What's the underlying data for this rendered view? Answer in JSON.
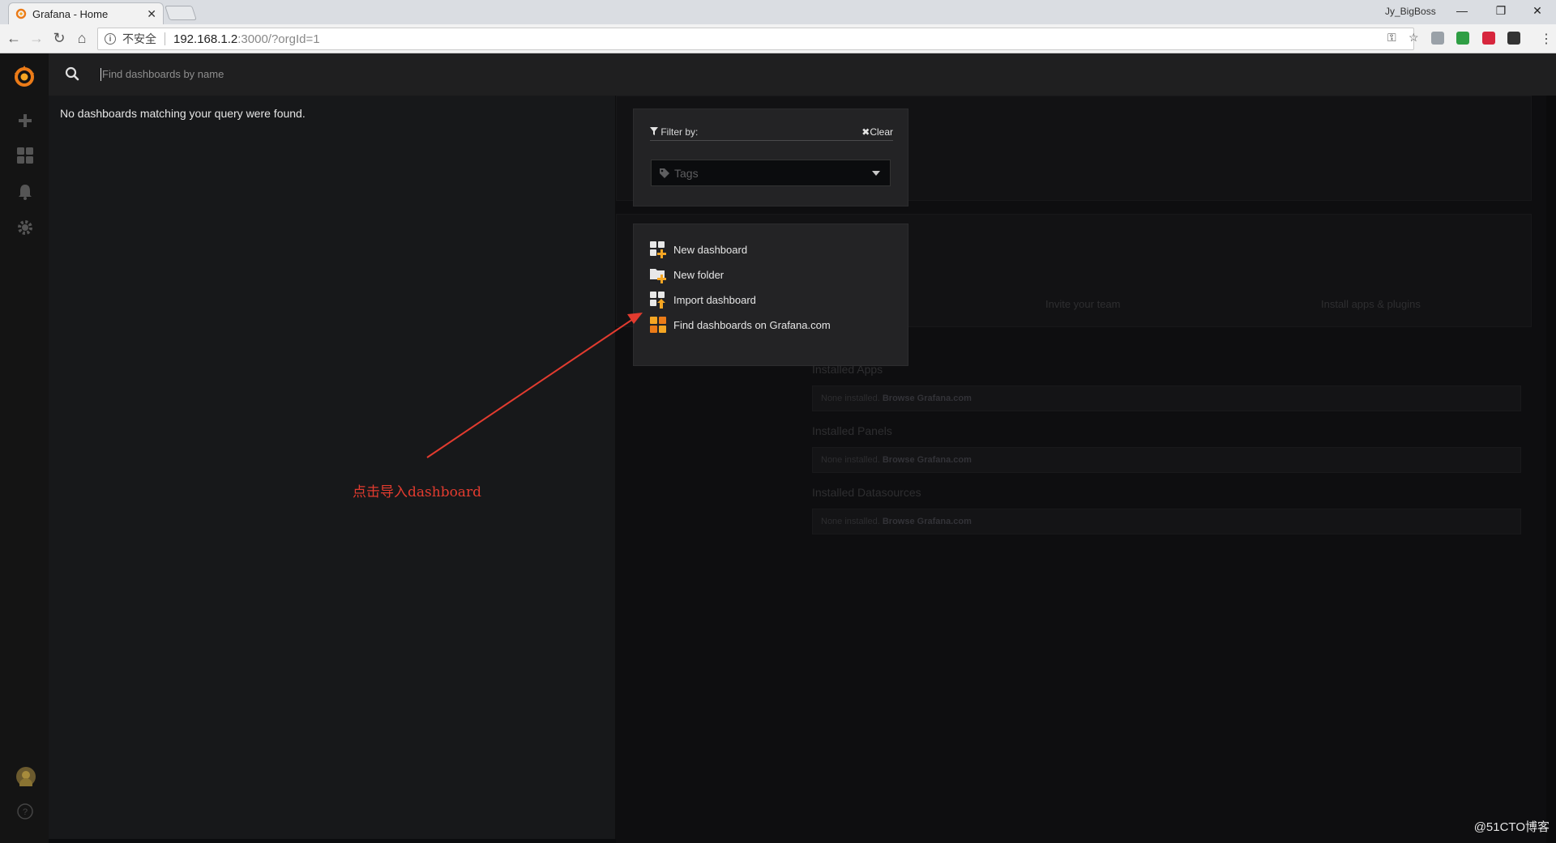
{
  "browser": {
    "tab_title": "Grafana - Home",
    "tab_close": "✕",
    "profile_name": "Jy_BigBoss",
    "window_buttons": [
      "—",
      "❐",
      "✕"
    ],
    "url_security": "不安全",
    "url_host": "192.168.1.2",
    "url_path": ":3000/?orgId=1"
  },
  "search": {
    "placeholder": "Find dashboards by name",
    "no_results": "No dashboards matching your query were found."
  },
  "filter": {
    "title": "Filter by:",
    "clear_label": "Clear",
    "tags_placeholder": "Tags"
  },
  "actions": [
    {
      "label": "New dashboard",
      "icon": "new-dashboard-icon"
    },
    {
      "label": "New folder",
      "icon": "new-folder-icon"
    },
    {
      "label": "Import dashboard",
      "icon": "import-dashboard-icon"
    },
    {
      "label": "Find dashboards on Grafana.com",
      "icon": "grafana-com-icon"
    }
  ],
  "background_home": {
    "invite_team": "Invite your team",
    "install_apps": "Install apps & plugins",
    "installed_apps": "Installed Apps",
    "installed_panels": "Installed Panels",
    "installed_datasources": "Installed Datasources",
    "none_installed": "None installed.",
    "browse_link": "Browse Grafana.com"
  },
  "annotation_text": "点击导入dashboard",
  "watermark": "@51CTO博客",
  "colors": {
    "accent_orange": "#eb7b18",
    "annotation_red": "#e23b2f"
  }
}
